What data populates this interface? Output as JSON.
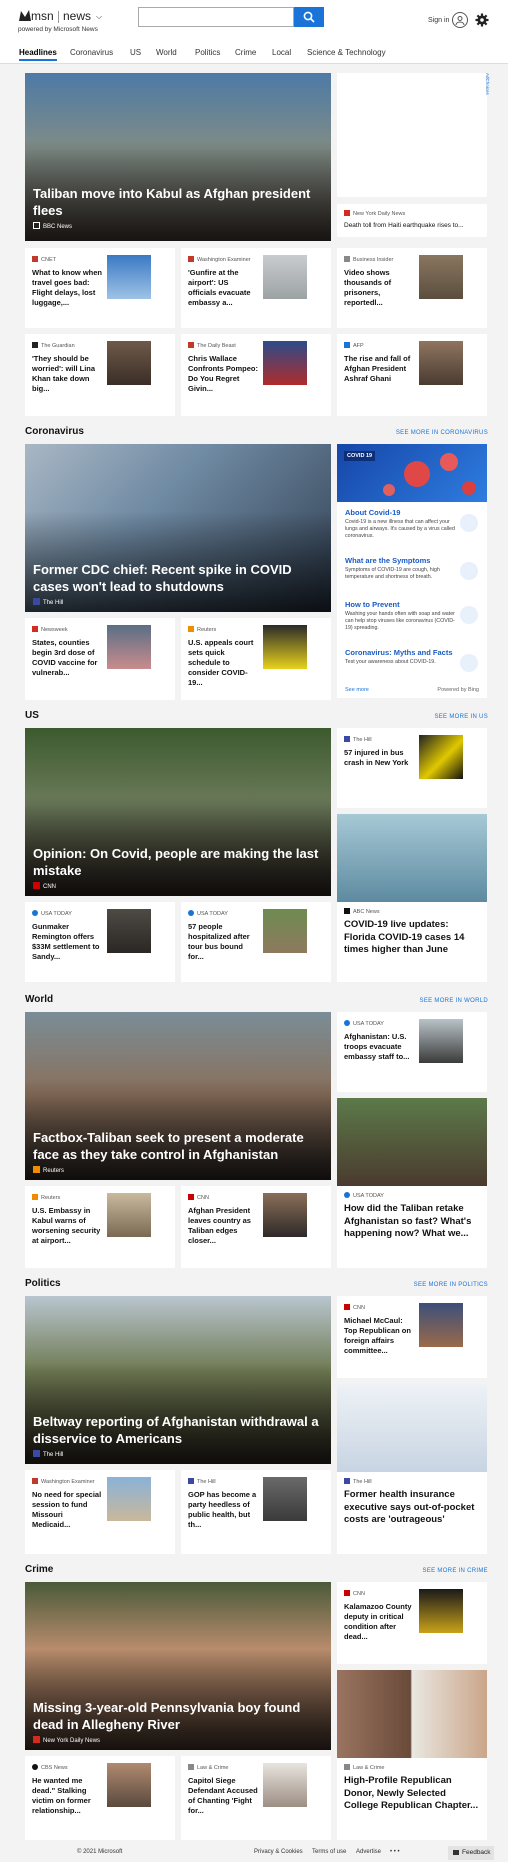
{
  "header": {
    "brand": "msn",
    "section": "news",
    "powered_by": "powered by Microsoft News",
    "search_placeholder": "",
    "signin": "Sign in"
  },
  "nav": [
    "Headlines",
    "Coronavirus",
    "US",
    "World",
    "Politics",
    "Crime",
    "Local",
    "Science & Technology"
  ],
  "headlines": {
    "hero": {
      "title": "Taliban move into Kabul as Afghan president flees",
      "source": "BBC News"
    },
    "ad_choices": "AdChoices",
    "side": {
      "source": "New York Daily News",
      "title": "Death toll from Haiti earthquake rises to..."
    },
    "cards": [
      {
        "source": "CNET",
        "title": "What to know when travel goes bad: Flight delays, lost luggage,..."
      },
      {
        "source": "Washington Examiner",
        "title": "'Gunfire at the airport': US officials evacuate embassy a..."
      },
      {
        "source": "Business Insider",
        "title": "Video shows thousands of prisoners, reportedl..."
      },
      {
        "source": "The Guardian",
        "title": "'They should be worried': will Lina Khan take down big..."
      },
      {
        "source": "The Daily Beast",
        "title": "Chris Wallace Confronts Pompeo: Do You Regret Givin..."
      },
      {
        "source": "AFP",
        "title": "The rise and fall of Afghan President Ashraf Ghani"
      }
    ]
  },
  "coronavirus": {
    "heading": "Coronavirus",
    "see_more": "SEE MORE IN CORONAVIRUS",
    "hero": {
      "title": "Former CDC chief: Recent spike in COVID cases won't lead to shutdowns",
      "source": "The Hill"
    },
    "cards": [
      {
        "source": "Newsweek",
        "title": "States, counties begin 3rd dose of COVID vaccine for vulnerab..."
      },
      {
        "source": "Reuters",
        "title": "U.S. appeals court sets quick schedule to consider COVID-19..."
      }
    ],
    "panel": {
      "tag": "COVID 19",
      "items": [
        {
          "title": "About Covid-19",
          "desc": "Covid-19 is a new illness that can affect your lungs and airways. It's caused by a virus called coronavirus."
        },
        {
          "title": "What are the Symptoms",
          "desc": "Symptoms of COVID-19 are cough, high temperature and shortness of breath."
        },
        {
          "title": "How to Prevent",
          "desc": "Washing your hands often with soap and water can help stop viruses like coronavirus (COVID-19) spreading."
        },
        {
          "title": "Coronavirus: Myths and Facts",
          "desc": "Test your awareness about COVID-19."
        }
      ],
      "see_more": "See more",
      "powered": "Powered by Bing"
    }
  },
  "us": {
    "heading": "US",
    "see_more": "SEE MORE IN US",
    "hero": {
      "title": "Opinion: On Covid, people are making the last mistake",
      "source": "CNN"
    },
    "side": {
      "source": "The Hill",
      "title": "57 injured in bus crash in New York"
    },
    "tall": {
      "source": "ABC News",
      "title": "COVID-19 live updates: Florida COVID-19 cases 14 times higher than June"
    },
    "cards": [
      {
        "source": "USA TODAY",
        "title": "Gunmaker Remington offers $33M settlement to Sandy..."
      },
      {
        "source": "USA TODAY",
        "title": "57 people hospitalized after tour bus bound for..."
      }
    ]
  },
  "world": {
    "heading": "World",
    "see_more": "SEE MORE IN WORLD",
    "hero": {
      "title": "Factbox-Taliban seek to present a moderate face as they take control in Afghanistan",
      "source": "Reuters"
    },
    "side": {
      "source": "USA TODAY",
      "title": "Afghanistan: U.S. troops evacuate embassy staff to..."
    },
    "tall": {
      "source": "USA TODAY",
      "title": "How did the Taliban retake Afghanistan so fast? What's happening now? What we..."
    },
    "cards": [
      {
        "source": "Reuters",
        "title": "U.S. Embassy in Kabul warns of worsening security at airport..."
      },
      {
        "source": "CNN",
        "title": "Afghan President leaves country as Taliban edges closer..."
      }
    ]
  },
  "politics": {
    "heading": "Politics",
    "see_more": "SEE MORE IN POLITICS",
    "hero": {
      "title": "Beltway reporting of Afghanistan withdrawal a disservice to Americans",
      "source": "The Hill"
    },
    "side": {
      "source": "CNN",
      "title": "Michael McCaul: Top Republican on foreign affairs committee..."
    },
    "tall": {
      "source": "The Hill",
      "title": "Former health insurance executive says out-of-pocket costs are 'outrageous'"
    },
    "cards": [
      {
        "source": "Washington Examiner",
        "title": "No need for special session to fund Missouri Medicaid..."
      },
      {
        "source": "The Hill",
        "title": "GOP has become a party heedless of public health, but th..."
      }
    ]
  },
  "crime": {
    "heading": "Crime",
    "see_more": "SEE MORE IN CRIME",
    "hero": {
      "title": "Missing 3-year-old Pennsylvania boy found dead in Allegheny River",
      "source": "New York Daily News"
    },
    "side": {
      "source": "CNN",
      "title": "Kalamazoo County deputy in critical condition after dead..."
    },
    "tall": {
      "source": "Law & Crime",
      "title": "High-Profile Republican Donor, Newly Selected College Republican Chapter..."
    },
    "cards": [
      {
        "source": "CBS News",
        "title": "He wanted me dead.\" Stalking victim on former relationship..."
      },
      {
        "source": "Law & Crime",
        "title": "Capitol Siege Defendant Accused of Chanting 'Fight for..."
      }
    ]
  },
  "footer": {
    "copyright": "© 2021 Microsoft",
    "links": [
      "Privacy & Cookies",
      "Terms of use",
      "Advertise"
    ],
    "more": "• • •",
    "feedback": "Feedback"
  },
  "colors": {
    "accent": "#1a73d6",
    "background": "#f3f3f3"
  }
}
